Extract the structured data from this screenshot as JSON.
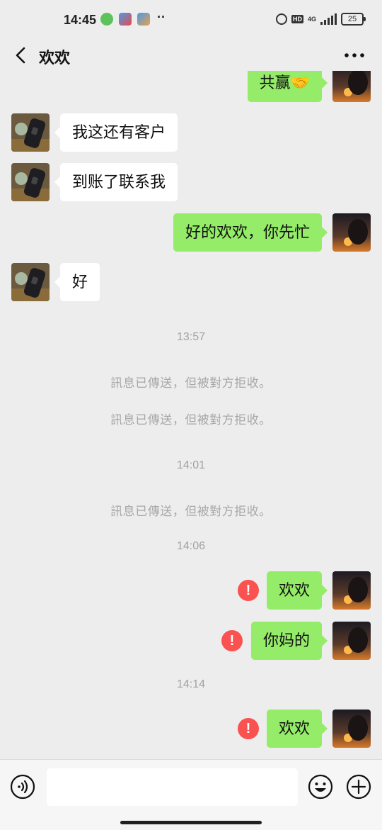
{
  "status_bar": {
    "time": "14:45",
    "network": "4G",
    "hd": "HD",
    "battery": "25"
  },
  "header": {
    "title": "欢欢",
    "back_icon": "chevron-left-icon",
    "more_icon": "more-dots-icon"
  },
  "messages": {
    "m0": {
      "text": "共赢🤝"
    },
    "m1": {
      "text": "我这还有客户"
    },
    "m2": {
      "text": "到账了联系我"
    },
    "m3": {
      "text": "好的欢欢，你先忙"
    },
    "m4": {
      "text": "好"
    },
    "t1": {
      "text": "13:57"
    },
    "n1": {
      "text": "訊息已傳送，但被對方拒收。"
    },
    "n2": {
      "text": "訊息已傳送，但被對方拒收。"
    },
    "t2": {
      "text": "14:01"
    },
    "n3": {
      "text": "訊息已傳送，但被對方拒收。"
    },
    "t3": {
      "text": "14:06"
    },
    "m5": {
      "text": "欢欢",
      "error": "!"
    },
    "m6": {
      "text": "你妈的",
      "error": "!"
    },
    "t4": {
      "text": "14:14"
    },
    "m7": {
      "text": "欢欢",
      "error": "!"
    }
  },
  "input_bar": {
    "value": "",
    "voice_icon": "voice-icon",
    "emoji_icon": "emoji-icon",
    "plus_icon": "plus-icon"
  },
  "colors": {
    "background": "#ededed",
    "outgoing_bubble": "#95ec69",
    "incoming_bubble": "#ffffff",
    "error": "#fa5151",
    "system_text": "#a1a1a1"
  }
}
